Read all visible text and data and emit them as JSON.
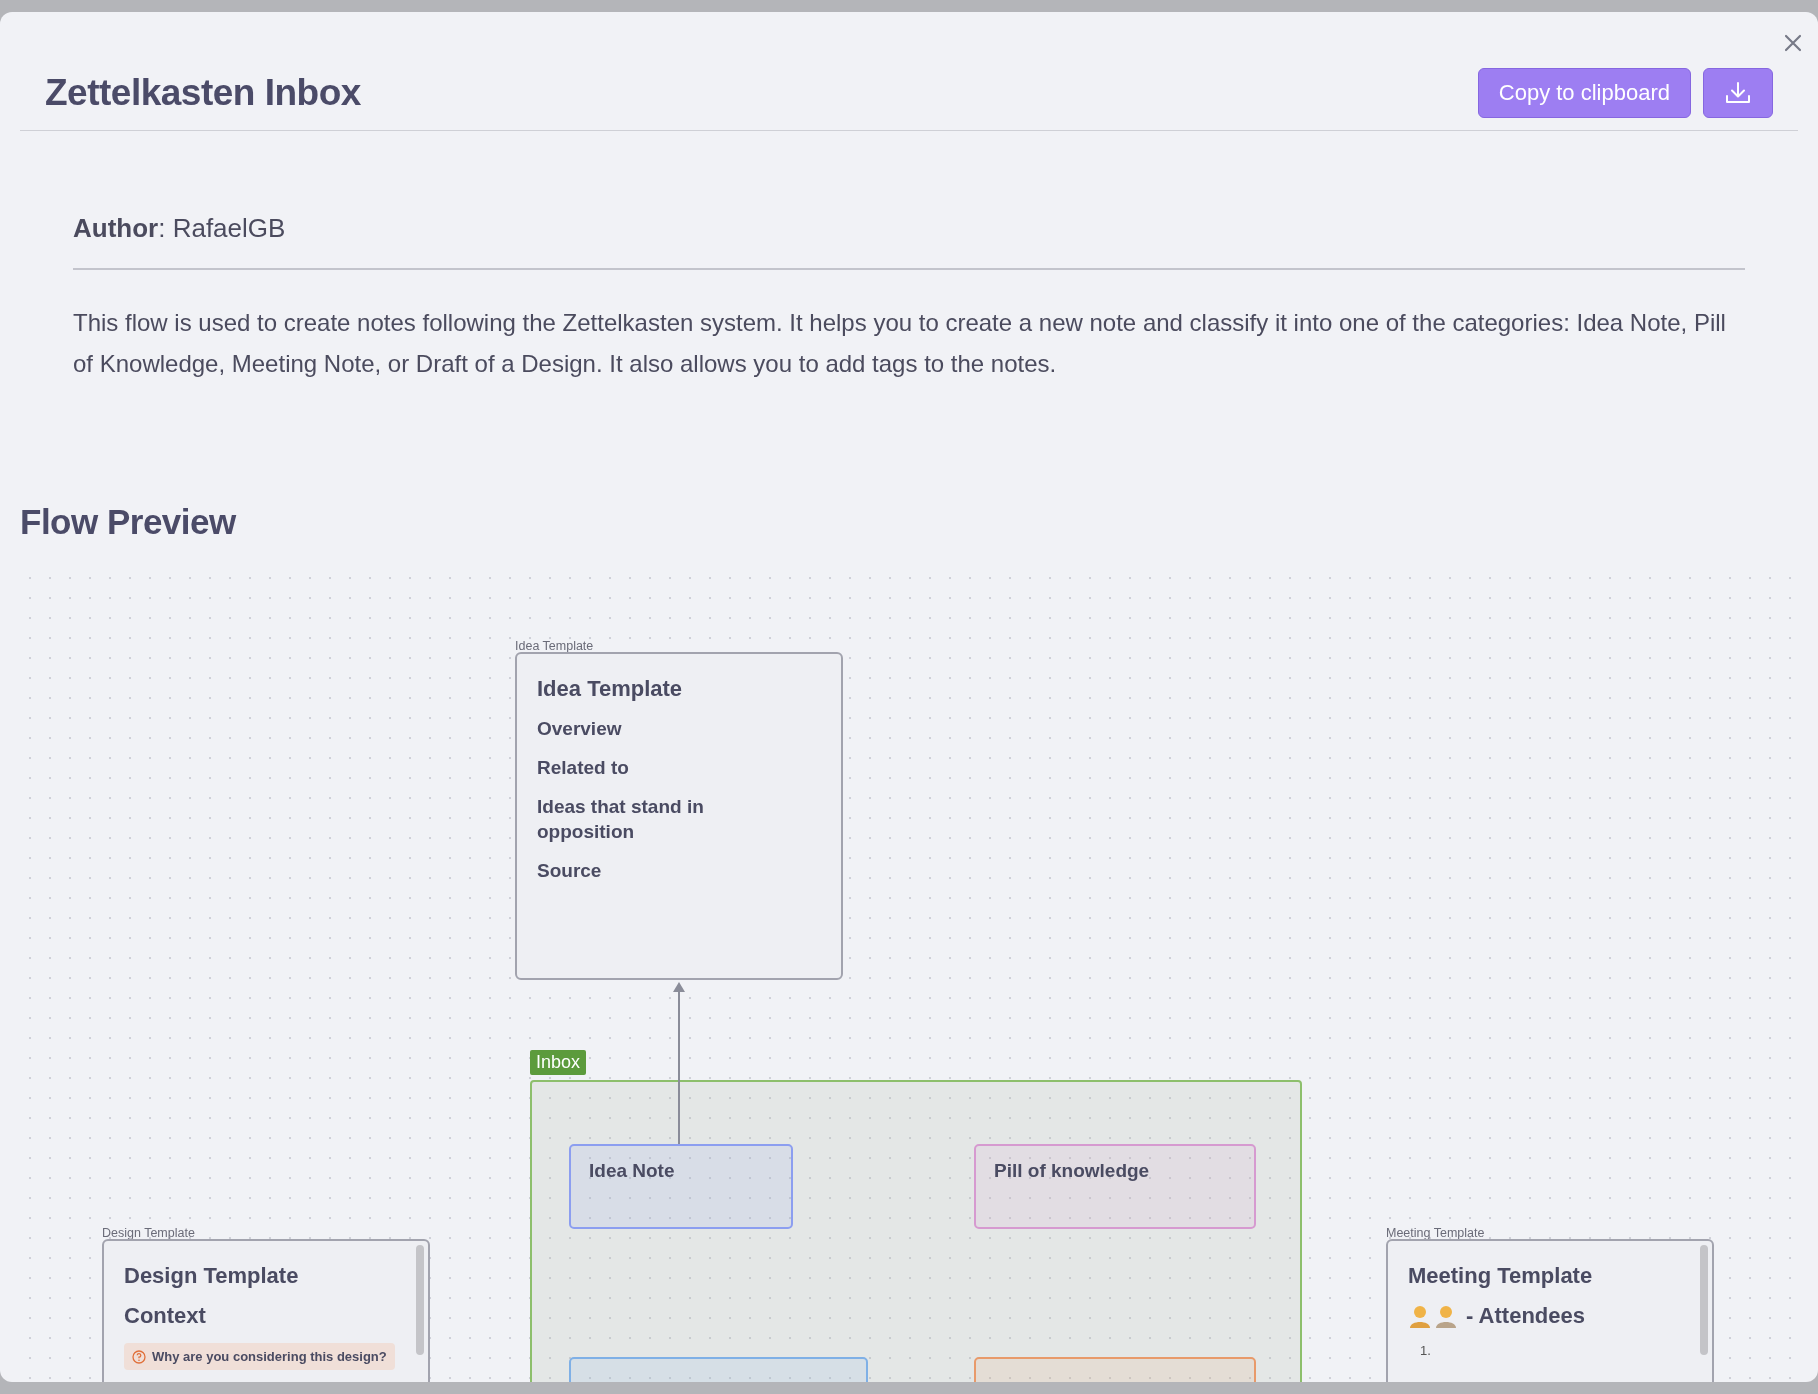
{
  "dialog": {
    "title": "Zettelkasten Inbox",
    "copy_button": "Copy to clipboard"
  },
  "author": "**Author**: RafaelGB",
  "description": "This flow is used to create notes following the Zettelkasten system. It helps you to create a new note and classify it into one of the categories: Idea Note, Pill of Knowledge, Meeting Note, or Draft of a Design. It also allows you to add tags to the notes.",
  "preview_heading": "Flow Preview",
  "canvas": {
    "templates": [
      {
        "label": "Idea Template",
        "scrollable": false,
        "blocks": [
          {
            "kind": "heading",
            "text": "Idea Template"
          },
          {
            "kind": "section",
            "text": "Overview"
          },
          {
            "kind": "section",
            "text": "Related to"
          },
          {
            "kind": "section",
            "text": "Ideas that stand in opposition"
          },
          {
            "kind": "section",
            "text": "Source"
          }
        ]
      },
      {
        "label": "Design Template",
        "scrollable": true,
        "blocks": [
          {
            "kind": "heading",
            "text": "Design Template"
          },
          {
            "kind": "heading",
            "text": "Context"
          },
          {
            "kind": "callout",
            "text": "Why are you considering this design?"
          }
        ]
      },
      {
        "label": "Meeting Template",
        "scrollable": true,
        "blocks": [
          {
            "kind": "heading",
            "text": "Meeting Template"
          },
          {
            "kind": "people",
            "text": "- Attendees"
          },
          {
            "kind": "list_item",
            "text": "1."
          }
        ]
      }
    ],
    "group": {
      "label": "Inbox",
      "cards": [
        {
          "title": "Idea Note",
          "color": "#8c9ef0"
        },
        {
          "title": "Pill of knowledge",
          "color": "#d69ad0"
        },
        {
          "color": "#7fb0e6"
        },
        {
          "color": "#e89a6a"
        }
      ]
    }
  }
}
